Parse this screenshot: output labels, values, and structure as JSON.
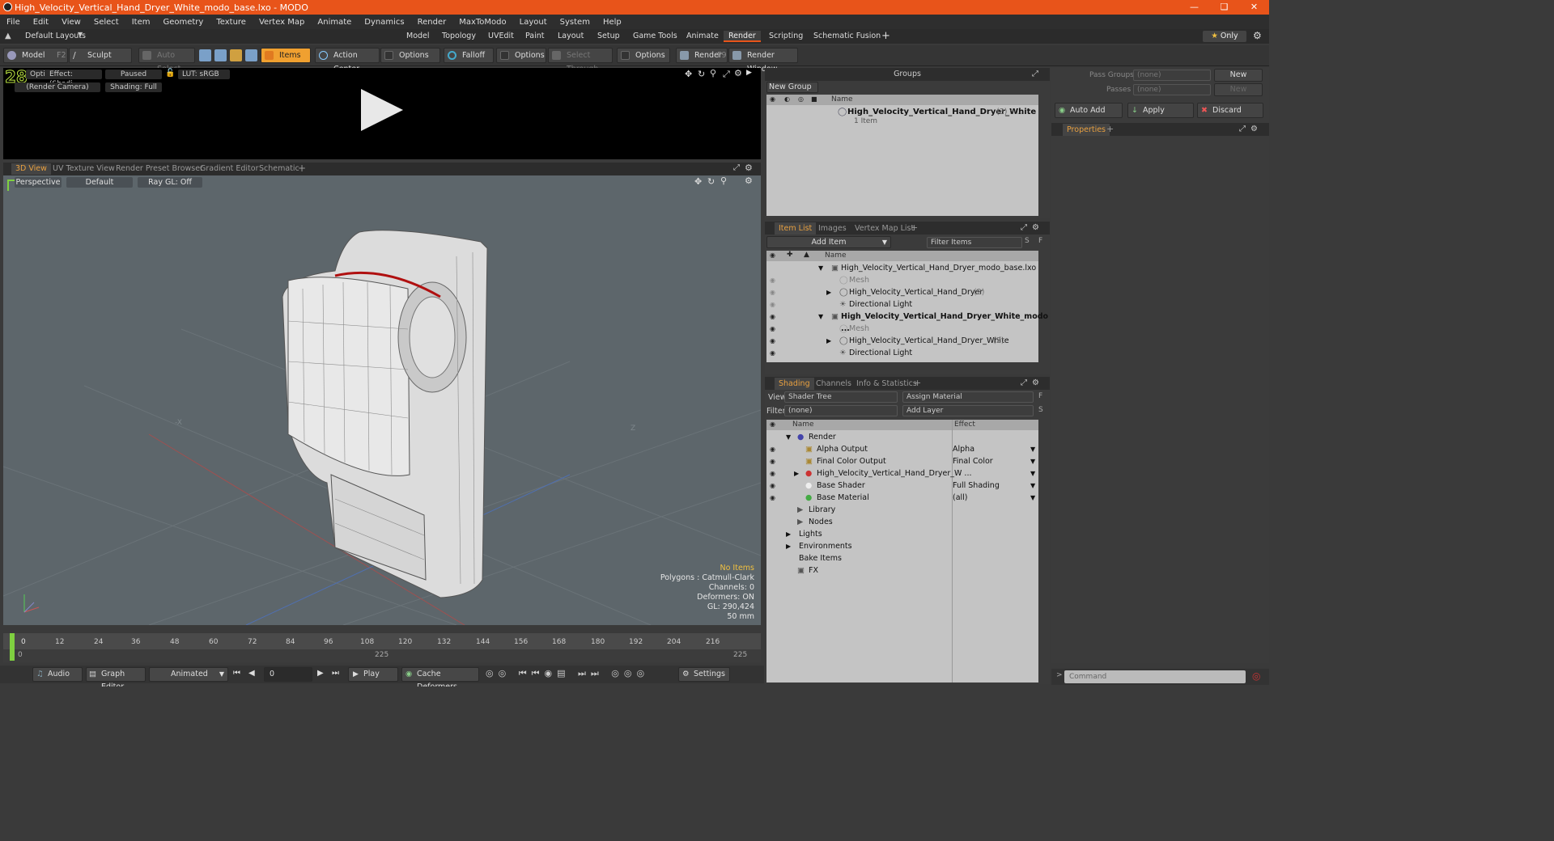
{
  "app": {
    "title": "High_Velocity_Vertical_Hand_Dryer_White_modo_base.lxo - MODO"
  },
  "menu": [
    "File",
    "Edit",
    "View",
    "Select",
    "Item",
    "Geometry",
    "Texture",
    "Vertex Map",
    "Animate",
    "Dynamics",
    "Render",
    "MaxToModo",
    "Layout",
    "System",
    "Help"
  ],
  "layout": {
    "name": "Default Layouts",
    "tabs": [
      "Model",
      "Topology",
      "UVEdit",
      "Paint",
      "Layout",
      "Setup",
      "Game Tools",
      "Animate",
      "Render",
      "Scripting",
      "Schematic Fusion"
    ],
    "active": "Render",
    "only": "Only"
  },
  "toolbar": {
    "model": "Model",
    "model_key": "F2",
    "sculpt": "Sculpt",
    "auto_select": "Auto Select",
    "items": "Items",
    "action_center": "Action Center",
    "options1": "Options",
    "falloff": "Falloff",
    "options2": "Options",
    "select_through": "Select Through",
    "options3": "Options",
    "render": "Render",
    "render_key": "F9",
    "render_window": "Render Window"
  },
  "preview": {
    "frame": "28",
    "options": "Options",
    "effect": "Effect: (Shadi...",
    "paused": "Paused",
    "lut": "LUT: sRGB",
    "camera": "(Render Camera)",
    "shading": "Shading: Full"
  },
  "viewtabs": [
    "3D View",
    "UV Texture View",
    "Render Preset Browser",
    "Gradient Editor",
    "Schematic"
  ],
  "viewport": {
    "projection": "Perspective",
    "style": "Default",
    "raygl": "Ray GL: Off",
    "axis_x": "-X",
    "axis_z": "Z"
  },
  "stats": {
    "no_items": "No Items",
    "polygons": "Polygons : Catmull-Clark",
    "channels": "Channels: 0",
    "deformers": "Deformers: ON",
    "gl": "GL: 290,424",
    "size": "50 mm"
  },
  "timeline": {
    "ticks": [
      "0",
      "12",
      "24",
      "36",
      "48",
      "60",
      "72",
      "84",
      "96",
      "108",
      "120",
      "132",
      "144",
      "156",
      "168",
      "180",
      "192",
      "204",
      "216"
    ],
    "sub_start": "0",
    "sub_mid": "225",
    "sub_end": "225"
  },
  "bottom": {
    "audio": "Audio",
    "graph_editor": "Graph Editor",
    "animated": "Animated",
    "frame": "0",
    "play": "Play",
    "cache": "Cache Deformers",
    "settings": "Settings"
  },
  "groups": {
    "header": "Groups",
    "new_group": "New Group",
    "col_name": "Name",
    "item": "High_Velocity_Vertical_Hand_Dryer_White",
    "item_count": "(3) : ...",
    "item_sub": "1 Item"
  },
  "passes": {
    "pass_groups_label": "Pass Groups",
    "pass_groups_val": "(none)",
    "passes_label": "Passes",
    "passes_val": "(none)",
    "new1": "New",
    "new2": "New",
    "auto_add": "Auto Add",
    "apply": "Apply",
    "discard": "Discard",
    "properties": "Properties"
  },
  "itemlist": {
    "tabs": [
      "Item List",
      "Images",
      "Vertex Map List"
    ],
    "add_item": "Add Item",
    "filter": "Filter Items",
    "col_name": "Name",
    "rows": [
      "High_Velocity_Vertical_Hand_Dryer_modo_base.lxo",
      "Mesh",
      "High_Velocity_Vertical_Hand_Dryer",
      "(2)",
      "Directional Light",
      "High_Velocity_Vertical_Hand_Dryer_White_modo ...",
      "Mesh",
      "High_Velocity_Vertical_Hand_Dryer_White",
      "(2)",
      "Directional Light"
    ]
  },
  "shading": {
    "tabs": [
      "Shading",
      "Channels",
      "Info & Statistics"
    ],
    "view_label": "View",
    "view_val": "Shader Tree",
    "assign": "Assign Material",
    "filter_label": "Filter",
    "filter_val": "(none)",
    "add_layer": "Add Layer",
    "col_name": "Name",
    "col_effect": "Effect",
    "rows": [
      {
        "name": "Render",
        "effect": ""
      },
      {
        "name": "Alpha Output",
        "effect": "Alpha"
      },
      {
        "name": "Final Color Output",
        "effect": "Final Color"
      },
      {
        "name": "High_Velocity_Vertical_Hand_Dryer_W ...",
        "effect": ""
      },
      {
        "name": "Base Shader",
        "effect": "Full Shading"
      },
      {
        "name": "Base Material",
        "effect": "(all)"
      },
      {
        "name": "Library",
        "effect": ""
      },
      {
        "name": "Nodes",
        "effect": ""
      },
      {
        "name": "Lights",
        "effect": ""
      },
      {
        "name": "Environments",
        "effect": ""
      },
      {
        "name": "Bake Items",
        "effect": ""
      },
      {
        "name": "FX",
        "effect": ""
      }
    ]
  },
  "command": {
    "placeholder": "Command"
  }
}
